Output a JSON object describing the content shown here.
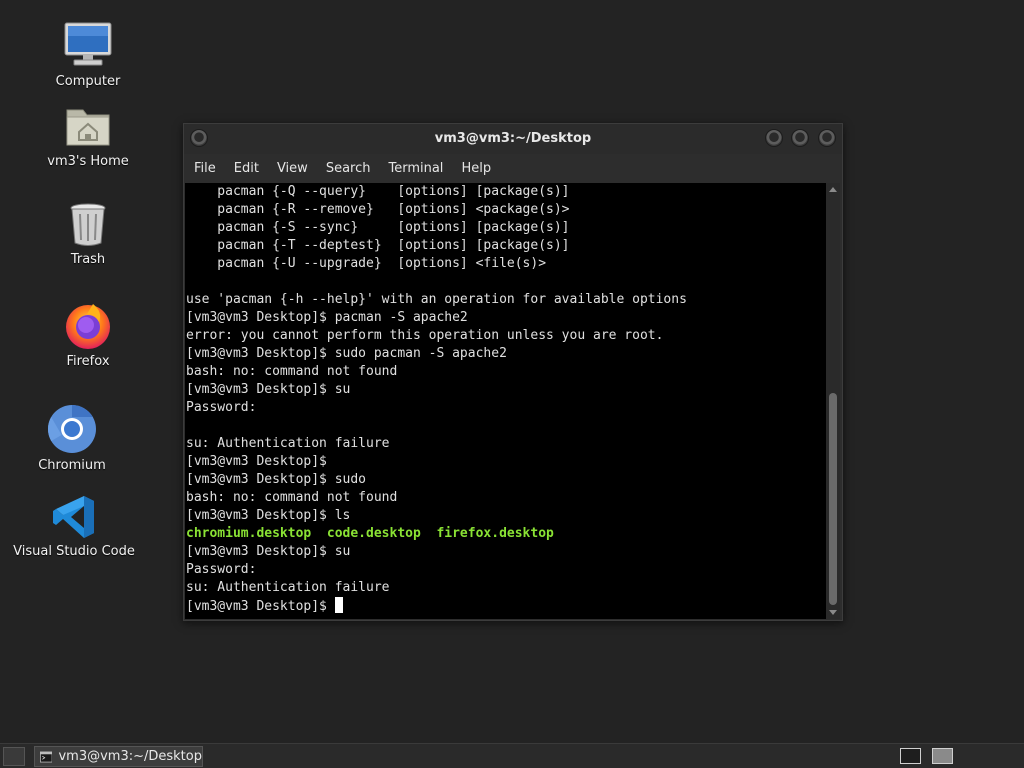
{
  "desktop": {
    "icons": [
      {
        "label": "Computer",
        "icon": "computer-icon"
      },
      {
        "label": "vm3's Home",
        "icon": "home-folder-icon"
      },
      {
        "label": "Trash",
        "icon": "trash-icon"
      },
      {
        "label": "Firefox",
        "icon": "firefox-icon"
      },
      {
        "label": "Chromium",
        "icon": "chromium-icon"
      },
      {
        "label": "Visual Studio Code",
        "icon": "vscode-icon"
      }
    ]
  },
  "window": {
    "title": "vm3@vm3:~/Desktop",
    "menu": [
      "File",
      "Edit",
      "View",
      "Search",
      "Terminal",
      "Help"
    ]
  },
  "terminal": {
    "lines": [
      "    pacman {-Q --query}    [options] [package(s)]",
      "    pacman {-R --remove}   [options] <package(s)>",
      "    pacman {-S --sync}     [options] [package(s)]",
      "    pacman {-T --deptest}  [options] [package(s)]",
      "    pacman {-U --upgrade}  [options] <file(s)>",
      "",
      "use 'pacman {-h --help}' with an operation for available options",
      "[vm3@vm3 Desktop]$ pacman -S apache2",
      "error: you cannot perform this operation unless you are root.",
      "[vm3@vm3 Desktop]$ sudo pacman -S apache2",
      "bash: no: command not found",
      "[vm3@vm3 Desktop]$ su",
      "Password:",
      "",
      "su: Authentication failure",
      "[vm3@vm3 Desktop]$",
      "[vm3@vm3 Desktop]$ sudo",
      "bash: no: command not found",
      "[vm3@vm3 Desktop]$ ls"
    ],
    "ls_output": "chromium.desktop  code.desktop  firefox.desktop",
    "lines_after": [
      "[vm3@vm3 Desktop]$ su",
      "Password:",
      "su: Authentication failure"
    ],
    "prompt": "[vm3@vm3 Desktop]$ "
  },
  "taskbar": {
    "window_button": "vm3@vm3:~/Desktop"
  },
  "colors": {
    "desktop_bg": "#232323",
    "terminal_bg": "#000000",
    "ls_green": "#8ae234"
  }
}
